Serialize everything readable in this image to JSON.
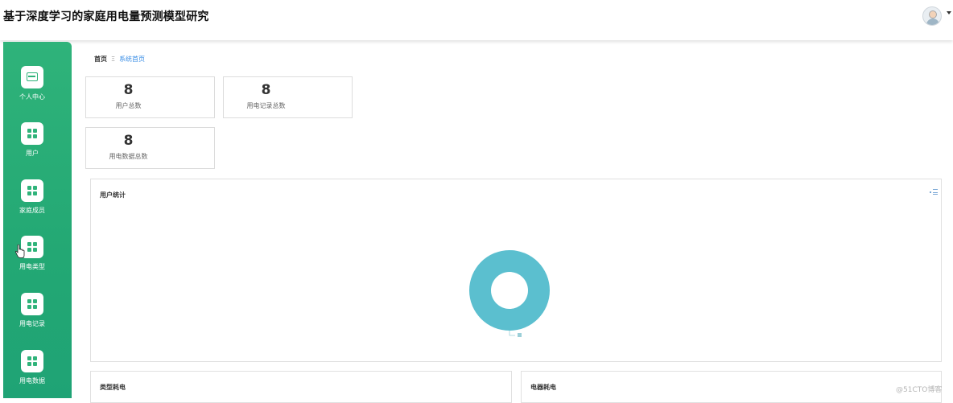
{
  "app": {
    "title": "基于深度学习的家庭用电量预测模型研究"
  },
  "sidebar": {
    "items": [
      {
        "label": "个人中心",
        "icon": "card-icon"
      },
      {
        "label": "用户",
        "icon": "grid-icon"
      },
      {
        "label": "家庭成员",
        "icon": "grid-icon"
      },
      {
        "label": "用电类型",
        "icon": "grid-icon"
      },
      {
        "label": "用电记录",
        "icon": "grid-icon"
      },
      {
        "label": "用电数据",
        "icon": "grid-icon"
      }
    ]
  },
  "breadcrumb": {
    "home": "首页",
    "separator": "Ξ",
    "current": "系统首页"
  },
  "stats": [
    {
      "value": "8",
      "label": "用户总数"
    },
    {
      "value": "8",
      "label": "用电记录总数"
    },
    {
      "value": "8",
      "label": "用电数据总数"
    }
  ],
  "panels": {
    "user_stats": {
      "title": "用户统计"
    },
    "type_consumption": {
      "title": "类型耗电"
    },
    "appliance_consumption": {
      "title": "电器耗电"
    }
  },
  "chart_data": {
    "type": "pie",
    "title": "用户统计",
    "slices": [
      {
        "label": "",
        "value": 100,
        "color": "#5bbfcf"
      }
    ],
    "legend": "none"
  },
  "watermark": "@51CTO博客",
  "colors": {
    "sidebar": "#2fb37a",
    "accent": "#3a8ee6",
    "donut": "#5bbfcf"
  }
}
